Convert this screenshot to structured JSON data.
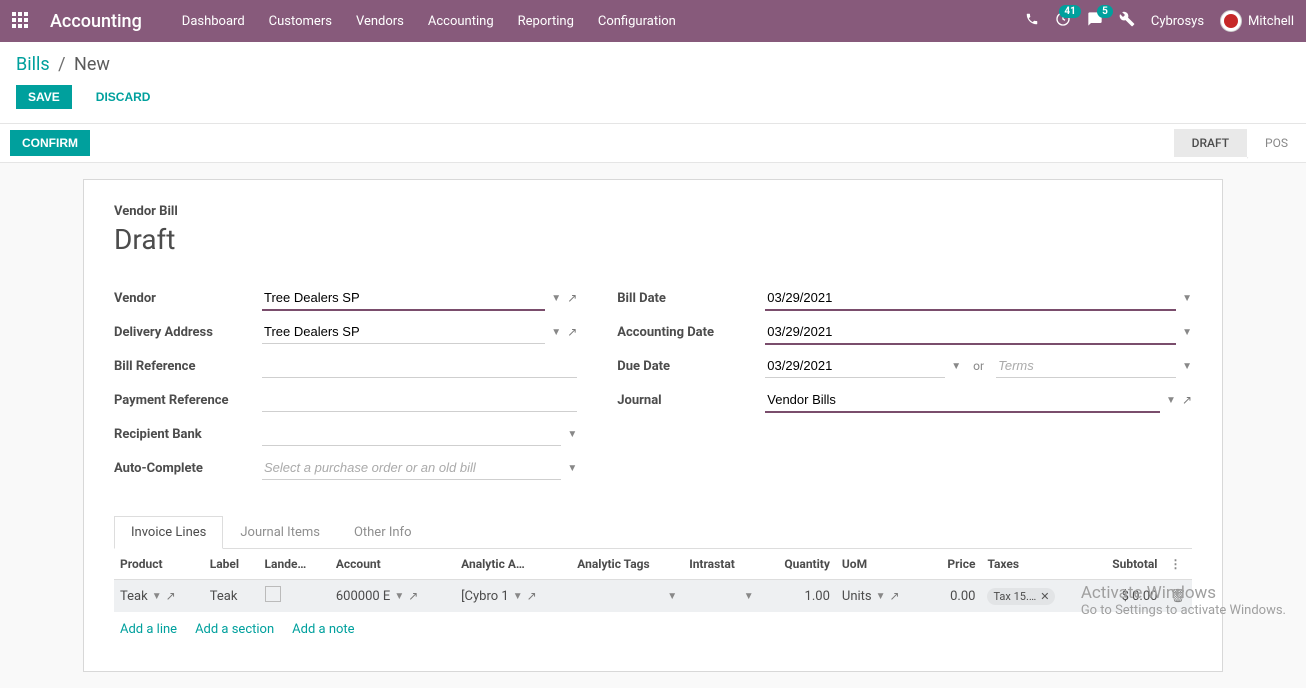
{
  "topbar": {
    "app_title": "Accounting",
    "menu": [
      "Dashboard",
      "Customers",
      "Vendors",
      "Accounting",
      "Reporting",
      "Configuration"
    ],
    "clock_badge": "41",
    "chat_badge": "5",
    "company": "Cybrosys",
    "user": "Mitchell"
  },
  "breadcrumb": {
    "root": "Bills",
    "current": "New"
  },
  "actions": {
    "save": "SAVE",
    "discard": "DISCARD",
    "confirm": "CONFIRM"
  },
  "status": {
    "draft": "DRAFT",
    "posted": "POS"
  },
  "titles": {
    "small": "Vendor Bill",
    "large": "Draft"
  },
  "labels": {
    "vendor": "Vendor",
    "delivery_address": "Delivery Address",
    "bill_reference": "Bill Reference",
    "payment_reference": "Payment Reference",
    "recipient_bank": "Recipient Bank",
    "auto_complete": "Auto-Complete",
    "bill_date": "Bill Date",
    "accounting_date": "Accounting Date",
    "due_date": "Due Date",
    "journal": "Journal",
    "or": "or"
  },
  "values": {
    "vendor": "Tree Dealers SP",
    "delivery_address": "Tree Dealers SP",
    "bill_reference": "",
    "payment_reference": "",
    "recipient_bank": "",
    "auto_complete_placeholder": "Select a purchase order or an old bill",
    "bill_date": "03/29/2021",
    "accounting_date": "03/29/2021",
    "due_date": "03/29/2021",
    "terms_placeholder": "Terms",
    "journal": "Vendor Bills"
  },
  "tabs": {
    "invoice_lines": "Invoice Lines",
    "journal_items": "Journal Items",
    "other_info": "Other Info"
  },
  "table": {
    "headers": {
      "product": "Product",
      "label": "Label",
      "landed": "Lande…",
      "account": "Account",
      "analytic_a": "Analytic A…",
      "analytic_tags": "Analytic Tags",
      "intrastat": "Intrastat",
      "quantity": "Quantity",
      "uom": "UoM",
      "price": "Price",
      "taxes": "Taxes",
      "subtotal": "Subtotal"
    },
    "row": {
      "product": "Teak",
      "label": "Teak",
      "account": "600000 E",
      "analytic_a": "[Cybro 1",
      "quantity": "1.00",
      "uom": "Units",
      "price": "0.00",
      "tax": "Tax 15.…",
      "subtotal": "$ 0.00"
    }
  },
  "addlinks": {
    "line": "Add a line",
    "section": "Add a section",
    "note": "Add a note"
  },
  "watermark": {
    "l1": "Activate Windows",
    "l2": "Go to Settings to activate Windows."
  }
}
